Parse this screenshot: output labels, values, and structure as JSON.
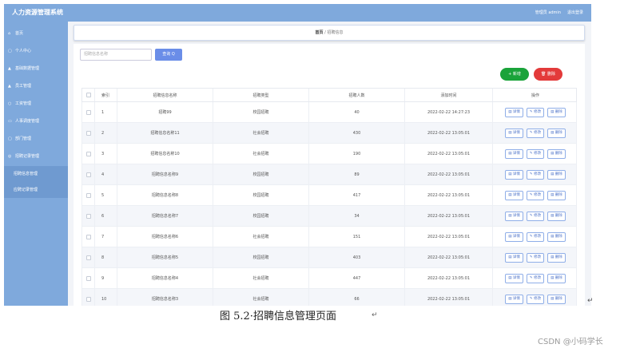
{
  "header": {
    "title": "人力资源管理系统",
    "user": "管理员 admin",
    "logout": "退出登录"
  },
  "sidebar": {
    "items": [
      {
        "label": "首页",
        "icon": "home-icon",
        "glyph": "⌂"
      },
      {
        "label": "个人中心",
        "icon": "user-icon",
        "glyph": "▢"
      },
      {
        "label": "基础数据管理",
        "icon": "people-icon",
        "glyph": "▲"
      },
      {
        "label": "员工管理",
        "icon": "staff-icon",
        "glyph": "▲"
      },
      {
        "label": "工资管理",
        "icon": "salary-icon",
        "glyph": "○"
      },
      {
        "label": "人事调度管理",
        "icon": "transfer-icon",
        "glyph": "▭"
      },
      {
        "label": "部门管理",
        "icon": "department-icon",
        "glyph": "▢"
      },
      {
        "label": "招聘记录管理",
        "icon": "recruit-icon",
        "glyph": "◎"
      }
    ],
    "subitems": [
      "招聘信息管理",
      "应聘记录管理"
    ]
  },
  "breadcrumb": {
    "home": "首页",
    "sep": "/",
    "current": "招聘信息"
  },
  "search": {
    "placeholder": "招聘信息名称",
    "button": "查询 Q"
  },
  "actions": {
    "add": "+ 新增",
    "delete": "🗑 删除"
  },
  "table": {
    "headers": [
      "索引",
      "招聘信息名称",
      "招聘类型",
      "招聘人数",
      "添加时间",
      "操作"
    ],
    "op_labels": {
      "detail": "▤ 详情",
      "edit": "✎ 修改",
      "delete": "▤ 删除"
    },
    "rows": [
      {
        "idx": "1",
        "name": "招聘99",
        "type": "校园招聘",
        "count": "40",
        "time": "2022-02-22 14:27:23"
      },
      {
        "idx": "2",
        "name": "招聘信息名称11",
        "type": "社会招聘",
        "count": "430",
        "time": "2022-02-22 13:05:01"
      },
      {
        "idx": "3",
        "name": "招聘信息名称10",
        "type": "社会招聘",
        "count": "190",
        "time": "2022-02-22 13:05:01"
      },
      {
        "idx": "4",
        "name": "招聘信息名称9",
        "type": "校园招聘",
        "count": "89",
        "time": "2022-02-22 13:05:01"
      },
      {
        "idx": "5",
        "name": "招聘信息名称8",
        "type": "校园招聘",
        "count": "417",
        "time": "2022-02-22 13:05:01"
      },
      {
        "idx": "6",
        "name": "招聘信息名称7",
        "type": "校园招聘",
        "count": "34",
        "time": "2022-02-22 13:05:01"
      },
      {
        "idx": "7",
        "name": "招聘信息名称6",
        "type": "社会招聘",
        "count": "151",
        "time": "2022-02-22 13:05:01"
      },
      {
        "idx": "8",
        "name": "招聘信息名称5",
        "type": "校园招聘",
        "count": "403",
        "time": "2022-02-22 13:05:01"
      },
      {
        "idx": "9",
        "name": "招聘信息名称4",
        "type": "社会招聘",
        "count": "447",
        "time": "2022-02-22 13:05:01"
      },
      {
        "idx": "10",
        "name": "招聘信息名称3",
        "type": "社会招聘",
        "count": "66",
        "time": "2022-02-22 13:05:01"
      }
    ]
  },
  "caption": "图 5.2·招聘信息管理页面",
  "caption_mark": "↵",
  "side_mark": "↵",
  "watermark": "CSDN @小码学长",
  "colors": {
    "theme": "#7fa9dc",
    "search_button": "#6a8de8",
    "add_button": "#1aa33a",
    "delete_button": "#e33a3a"
  }
}
